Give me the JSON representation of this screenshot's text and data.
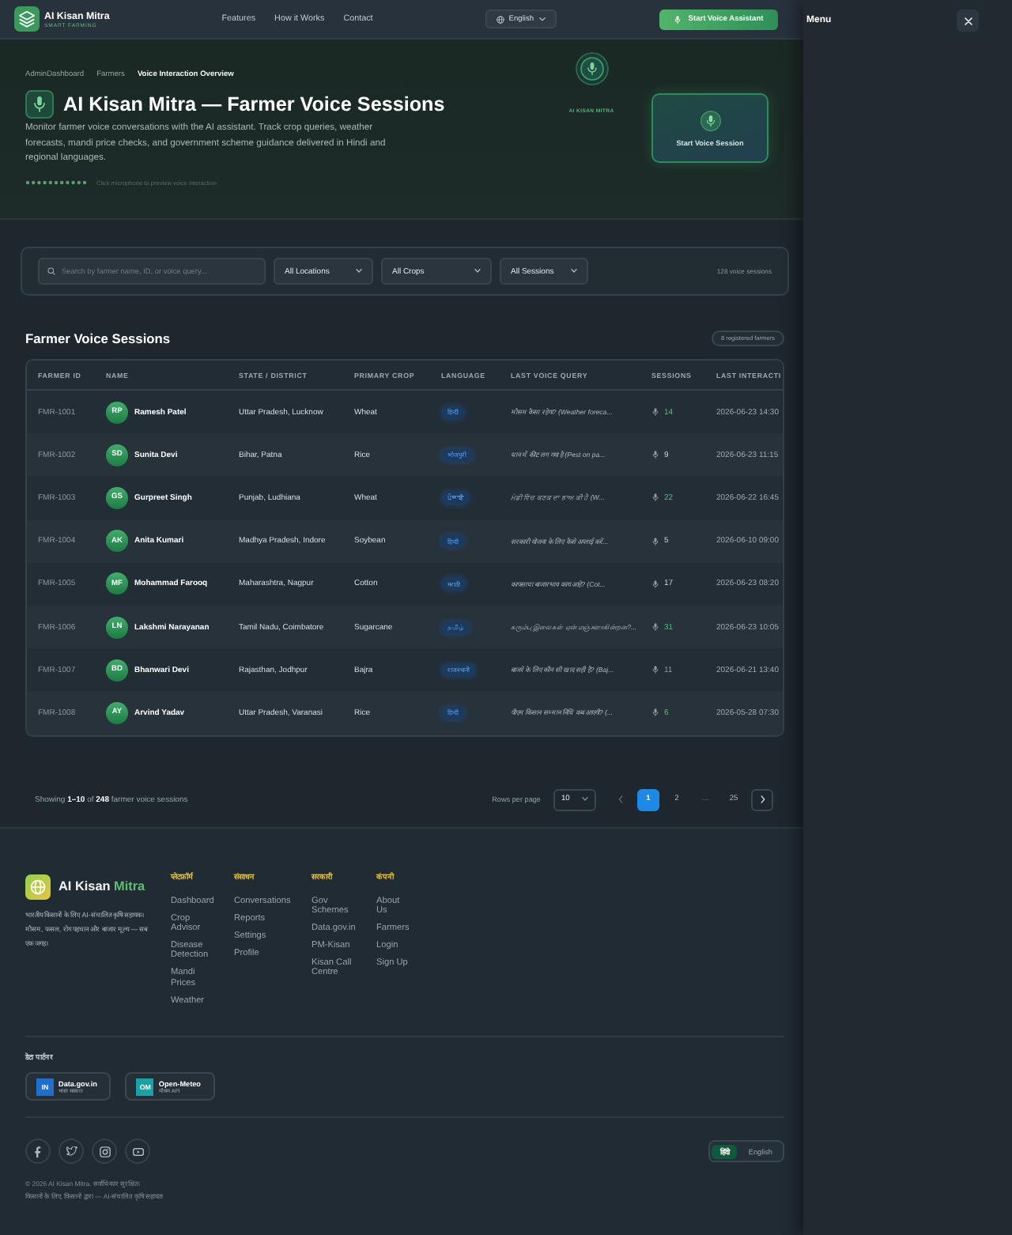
{
  "header": {
    "brand": "AI Kisan Mitra",
    "tagline": "SMART FARMING",
    "nav": [
      "Features",
      "How it Works",
      "Contact"
    ],
    "language": "English",
    "cta": "Start Voice Assistant"
  },
  "menu_panel": {
    "title": "Menu"
  },
  "breadcrumb": [
    {
      "label": "AdminDashboard",
      "selected": false
    },
    {
      "label": "Farmers",
      "selected": false
    },
    {
      "label": "Voice Interaction Overview",
      "selected": true
    }
  ],
  "hero": {
    "title": "AI Kisan Mitra — Farmer Voice Sessions",
    "description": "Monitor farmer voice conversations with the AI assistant. Track crop queries, weather forecasts, mandi price checks, and government scheme guidance delivered in Hindi and regional languages.",
    "hint": "Click microphone to preview voice interaction",
    "orb_label": "AI KISAN MITRA",
    "session_button": "Start Voice Session"
  },
  "filters": {
    "search": {
      "placeholder": "Search by farmer name, ID, or voice query..."
    },
    "selects": [
      "All Locations",
      "All Crops",
      "All Sessions"
    ],
    "count": "128 voice sessions"
  },
  "table": {
    "title": "Farmer Voice Sessions",
    "badge": "8 registered farmers",
    "columns": [
      "FARMER ID",
      "NAME",
      "STATE / DISTRICT",
      "PRIMARY CROP",
      "LANGUAGE",
      "LAST VOICE QUERY",
      "SESSIONS",
      "LAST INTERACTI"
    ],
    "rows": [
      {
        "id": "FMR-1001",
        "initials": "RP",
        "name": "Ramesh Patel",
        "location": "Uttar Pradesh, Lucknow",
        "crop": "Wheat",
        "language": "हिन्दी",
        "query": "मौसम कैसा रहेगा? (Weather foreca...",
        "sessions": "14",
        "active": true,
        "last": "2026-06-23 14:30"
      },
      {
        "id": "FMR-1002",
        "initials": "SD",
        "name": "Sunita Devi",
        "location": "Bihar, Patna",
        "crop": "Rice",
        "language": "भोजपुरी",
        "query": "धान में कीट लग गया है (Pest on pa...",
        "sessions": "9",
        "active": false,
        "last": "2026-06-23 11:15"
      },
      {
        "id": "FMR-1003",
        "initials": "GS",
        "name": "Gurpreet Singh",
        "location": "Punjab, Ludhiana",
        "crop": "Wheat",
        "language": "ਪੰਜਾਬੀ",
        "query": "ਮੰਡੀ ਵਿੱਚ ਕਣਕ ਦਾ ਭਾਅ ਕੀ ਹੈ (W...",
        "sessions": "22",
        "active": true,
        "last": "2026-06-22 16:45"
      },
      {
        "id": "FMR-1004",
        "initials": "AK",
        "name": "Anita Kumari",
        "location": "Madhya Pradesh, Indore",
        "crop": "Soybean",
        "language": "हिन्दी",
        "query": "सरकारी योजना के लिए कैसे अप्लाई करें...",
        "sessions": "5",
        "active": false,
        "last": "2026-06-10 09:00"
      },
      {
        "id": "FMR-1005",
        "initials": "MF",
        "name": "Mohammad Farooq",
        "location": "Maharashtra, Nagpur",
        "crop": "Cotton",
        "language": "मराठी",
        "query": "कापसाचा बाजारभाव काय आहे? (Cot...",
        "sessions": "17",
        "active": false,
        "last": "2026-06-23 08:20"
      },
      {
        "id": "FMR-1006",
        "initials": "LN",
        "name": "Lakshmi Narayanan",
        "location": "Tamil Nadu, Coimbatore",
        "crop": "Sugarcane",
        "language": "தமிழ்",
        "query": "கரும்பு இலைகள் ஏன் மஞ்சளாகின்றன?...",
        "sessions": "31",
        "active": true,
        "last": "2026-06-23 10:05"
      },
      {
        "id": "FMR-1007",
        "initials": "BD",
        "name": "Bhanwari Devi",
        "location": "Rajasthan, Jodhpur",
        "crop": "Bajra",
        "language": "राजस्थानी",
        "query": "बाजरे के लिए कौन सी खाद सही है? (Baj...",
        "sessions": "11",
        "active": true,
        "last": "2026-06-21 13:40"
      },
      {
        "id": "FMR-1008",
        "initials": "AY",
        "name": "Arvind Yadav",
        "location": "Uttar Pradesh, Varanasi",
        "crop": "Rice",
        "language": "हिन्दी",
        "query": "पीएम किसान सम्मान निधि कब आएगी? (...",
        "sessions": "6",
        "active": true,
        "last": "2026-05-28 07:30"
      }
    ]
  },
  "pagination": {
    "summary": "Showing **1–10** of **248** farmer voice sessions",
    "rows_label": "Rows per page",
    "rows_value": "10",
    "previous": {
      "disabled": true
    },
    "next": {
      "disabled": false
    },
    "pages": [
      {
        "label": "1",
        "selected": true,
        "kind": "page"
      },
      {
        "label": "2",
        "selected": false,
        "kind": "page"
      },
      {
        "label": "…",
        "selected": false,
        "kind": "ellipsis"
      },
      {
        "label": "25",
        "selected": false,
        "kind": "page"
      }
    ]
  },
  "footer": {
    "brand": "AI Kisan",
    "brand_accent": "Mitra",
    "description": "भारतीय किसानों के लिए AI-संचालित कृषि सहायक। मौसम, फसल, रोग पहचान और बाजार मूल्य — सब एक जगह।",
    "columns": [
      {
        "heading": "प्लेटफ़ॉर्म",
        "links": [
          "Dashboard",
          "Crop Advisor",
          "Disease Detection",
          "Mandi Prices",
          "Weather"
        ]
      },
      {
        "heading": "संसाधन",
        "links": [
          "Conversations",
          "Reports",
          "Settings",
          "Profile"
        ]
      },
      {
        "heading": "सरकारी",
        "links": [
          "Gov Schemes",
          "Data.gov.in",
          "PM-Kisan",
          "Kisan Call Centre"
        ]
      },
      {
        "heading": "कंपनी",
        "links": [
          "About Us",
          "Farmers",
          "Login",
          "Sign Up"
        ]
      }
    ],
    "partners_title": "डेटा पार्टनर",
    "partners": [
      {
        "badge": "IN",
        "name": "Data.gov.in",
        "note": "भारत सरकार",
        "color": "#1f6fd1"
      },
      {
        "badge": "OM",
        "name": "Open-Meteo",
        "note": "मौसम API",
        "color": "#17a2a8"
      }
    ],
    "socials": [
      {
        "kind": "facebook"
      },
      {
        "kind": "twitter"
      },
      {
        "kind": "instagram"
      },
      {
        "kind": "youtube"
      }
    ],
    "languages": [
      {
        "label": "हिंदी",
        "selected": true
      },
      {
        "label": "English",
        "selected": false
      }
    ],
    "copyright": [
      "© 2026 AI Kisan Mitra. सर्वाधिकार सुरक्षित।",
      "किसानों के लिए, किसानों द्वारा — AI-संचालित कृषि सहायता"
    ]
  }
}
